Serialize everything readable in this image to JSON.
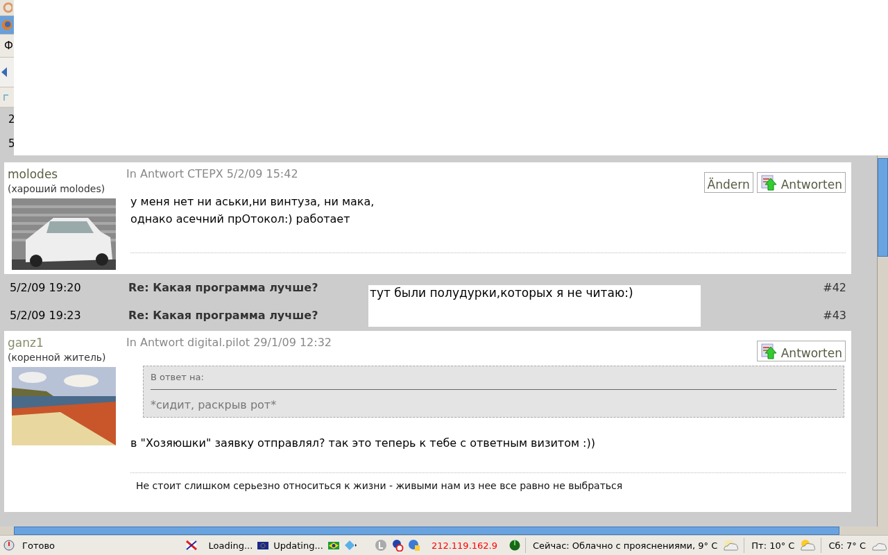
{
  "browser_strip": {
    "menu_fragment": "Ф",
    "content_fragments": [
      "2",
      "5"
    ]
  },
  "thread": [
    {
      "kind": "post",
      "author": "molodes",
      "color": "#5b5e40",
      "rank": "(хароший molodes)",
      "header": "In Antwort CTEPX 5/2/09 15:42",
      "avatar": {
        "kind": "picture"
      },
      "buttons": [
        {
          "kind": "edit",
          "label": "Ändern"
        },
        {
          "kind": "reply",
          "label": "Antworten"
        }
      ],
      "body": "у меня нет ни аськи,ни винтуза, ни мака,\nоднако асечний прОтокол:) работает"
    },
    {
      "kind": "row",
      "date": "5/2/09 19:20",
      "title": "Re: Какая программа лучше?",
      "number": "#42"
    },
    {
      "kind": "row",
      "date": "5/2/09 19:23",
      "title": "Re: Какая программа лучше?",
      "number": "#43"
    },
    {
      "kind": "post",
      "author": "ganz1",
      "color": "#8a8d6c",
      "rank": "(коренной житель)",
      "header": "In Antwort digital.pilot 29/1/09 12:32",
      "avatar": {
        "kind": "picture"
      },
      "buttons": [
        {
          "kind": "reply",
          "label": "Antworten"
        }
      ],
      "quote": {
        "label": "В ответ на:",
        "text": "*сидит, раскрыв рот*"
      },
      "body": "в \"Хозяюшки\" заявку отправлял? так это теперь к тебе с ответным визитом :))",
      "signature": "Не стоит слишком серьезно относиться к жизни - живыми нам из нее все равно не выбраться"
    }
  ],
  "overlay_note": "тут были полудурки,которых я не читаю:)",
  "status_bar": {
    "status": "Готово",
    "loading": "Loading...",
    "updating": "Updating...",
    "ip": "212.119.162.9",
    "weather": [
      "Сейчас: Облачно с прояснениями, 9° C",
      "Пт: 10° C",
      "Сб: 7° C"
    ]
  }
}
